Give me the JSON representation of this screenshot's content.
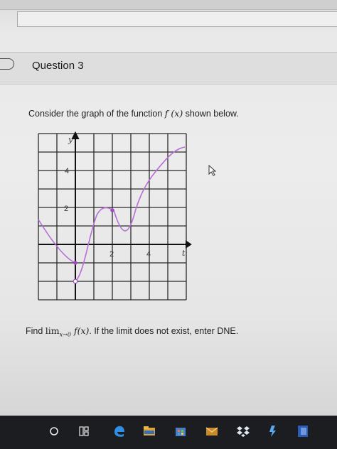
{
  "question": {
    "title": "Question 3",
    "prompt_prefix": "Consider the graph of the function ",
    "function_name": "f (x)",
    "prompt_suffix": " shown below.",
    "find_prefix": "Find ",
    "limit_text": "lim",
    "limit_sub": "x→0",
    "limit_func": " f(x)",
    "find_suffix": ". If the limit does not exist, enter DNE."
  },
  "graph": {
    "y_axis_label": "y",
    "x_axis_label": "t",
    "y_tick_labels": [
      "4",
      "2"
    ],
    "x_tick_labels": [
      "2",
      "4"
    ],
    "curve_color": "#b86ed6"
  },
  "taskbar": {
    "icons": [
      "cortana-circle-icon",
      "task-view-icon",
      "edge-icon",
      "file-explorer-icon",
      "store-icon",
      "mail-icon",
      "dropbox-icon",
      "app-icon",
      "word-icon"
    ]
  }
}
